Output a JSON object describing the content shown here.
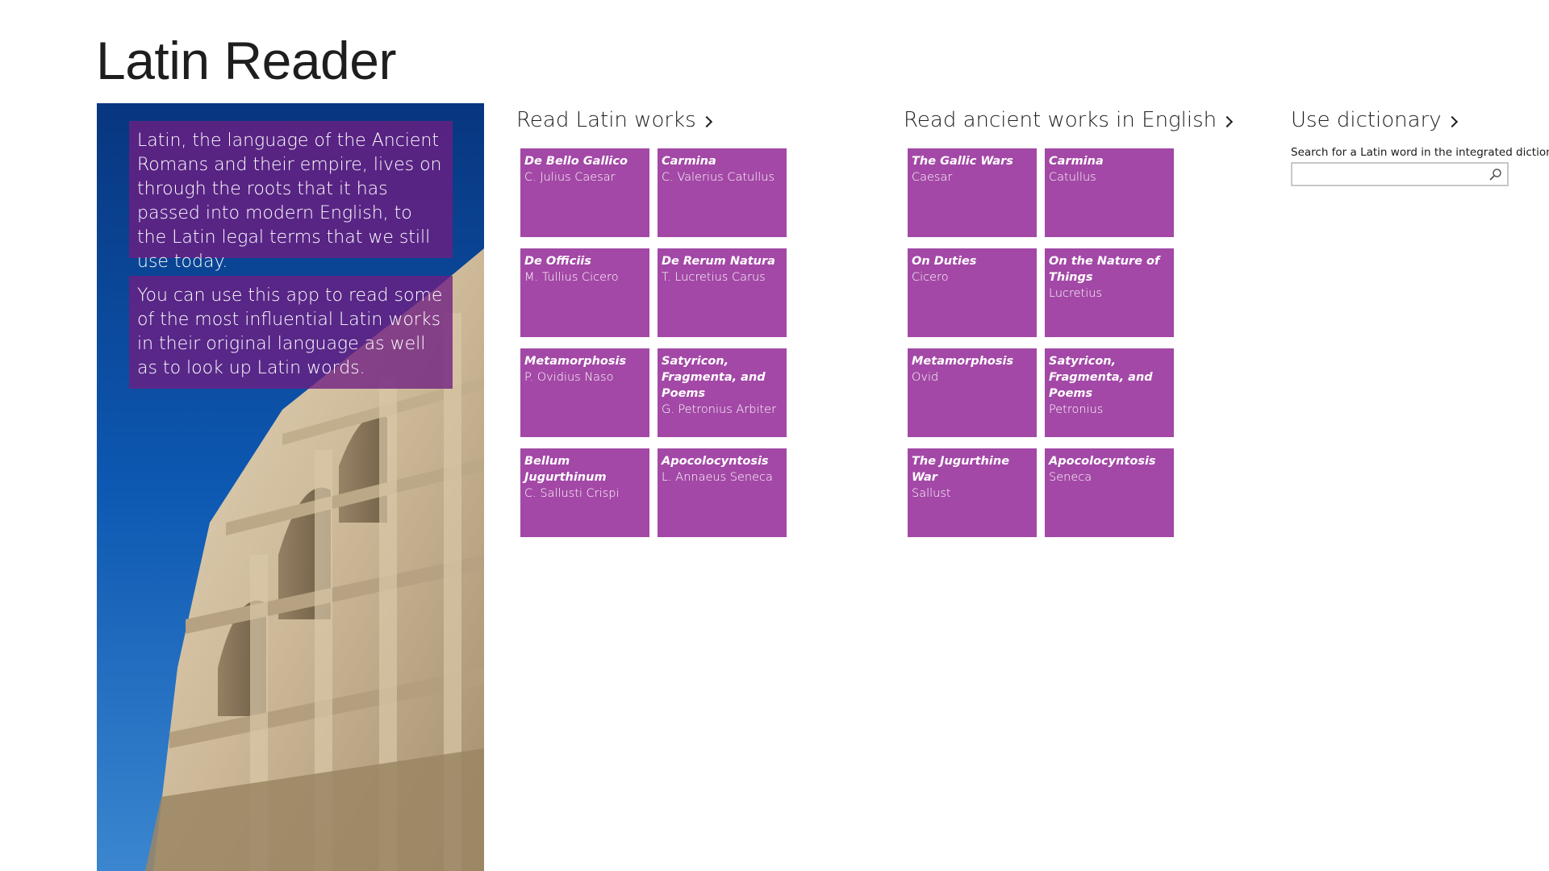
{
  "app": {
    "title": "Latin Reader"
  },
  "hero": {
    "paragraph1": "Latin, the language of the Ancient Romans and their empire, lives on through the roots that it has passed into modern English, to the Latin legal terms that we still use today.",
    "paragraph2": "You can use this app to read some of the most influential Latin works in their original language as well as to look up Latin words."
  },
  "sections": {
    "latin": {
      "title": "Read Latin works",
      "tiles": [
        {
          "title": "De Bello Gallico",
          "author": "C. Julius Caesar"
        },
        {
          "title": "Carmina",
          "author": "C. Valerius Catullus"
        },
        {
          "title": "De Officiis",
          "author": "M. Tullius Cicero"
        },
        {
          "title": "De Rerum Natura",
          "author": "T. Lucretius Carus"
        },
        {
          "title": "Metamorphosis",
          "author": "P. Ovidius Naso"
        },
        {
          "title": "Satyricon, Fragmenta, and Poems",
          "author": "G. Petronius Arbiter"
        },
        {
          "title": "Bellum Jugurthinum",
          "author": "C. Sallusti Crispi"
        },
        {
          "title": "Apocolocyntosis",
          "author": "L. Annaeus Seneca"
        }
      ]
    },
    "english": {
      "title": "Read ancient works in English",
      "tiles": [
        {
          "title": "The Gallic Wars",
          "author": "Caesar"
        },
        {
          "title": "Carmina",
          "author": "Catullus"
        },
        {
          "title": "On Duties",
          "author": "Cicero"
        },
        {
          "title": "On the Nature of Things",
          "author": "Lucretius"
        },
        {
          "title": "Metamorphosis",
          "author": "Ovid"
        },
        {
          "title": "Satyricon, Fragmenta, and Poems",
          "author": "Petronius"
        },
        {
          "title": "The Jugurthine War",
          "author": "Sallust"
        },
        {
          "title": "Apocolocyntosis",
          "author": "Seneca"
        }
      ]
    },
    "dictionary": {
      "title": "Use dictionary",
      "label": "Search for a Latin word in the integrated dictiona",
      "search_value": "",
      "search_placeholder": ""
    }
  },
  "colors": {
    "tile": "#a348a6",
    "hero_overlay": "#6e1e82",
    "sky": "#0c55b0"
  },
  "icons": {
    "search": "search-icon",
    "chevron": "chevron-right-icon"
  }
}
